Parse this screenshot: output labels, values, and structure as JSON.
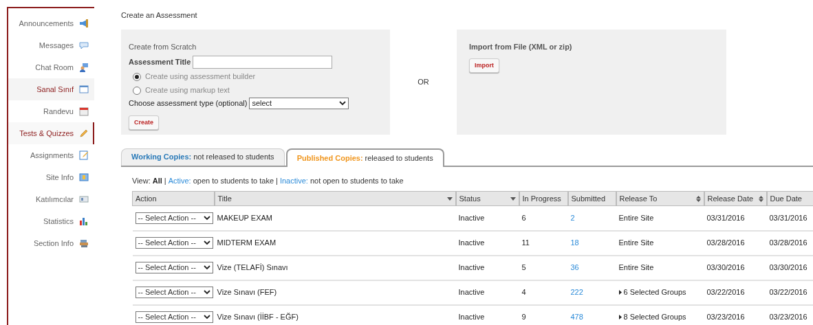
{
  "sidebar": {
    "items": [
      {
        "label": "Announcements",
        "selected": false,
        "hovered": false
      },
      {
        "label": "Messages",
        "selected": false,
        "hovered": false
      },
      {
        "label": "Chat Room",
        "selected": false,
        "hovered": false
      },
      {
        "label": "Sanal Sınıf",
        "selected": false,
        "hovered": true
      },
      {
        "label": "Randevu",
        "selected": false,
        "hovered": false
      },
      {
        "label": "Tests & Quizzes",
        "selected": true,
        "hovered": false
      },
      {
        "label": "Assignments",
        "selected": false,
        "hovered": false
      },
      {
        "label": "Site Info",
        "selected": false,
        "hovered": false
      },
      {
        "label": "Katılımcılar",
        "selected": false,
        "hovered": false
      },
      {
        "label": "Statistics",
        "selected": false,
        "hovered": false
      },
      {
        "label": "Section Info",
        "selected": false,
        "hovered": false
      }
    ]
  },
  "page_title": "Create an Assessment",
  "scratch": {
    "heading": "Create from Scratch",
    "title_label": "Assessment Title",
    "options": [
      {
        "label": "Create using assessment builder",
        "selected": true
      },
      {
        "label": "Create using markup text",
        "selected": false
      }
    ],
    "type_label": "Choose assessment type (optional)",
    "type_value": "select",
    "button": "Create"
  },
  "or_label": "OR",
  "import": {
    "heading": "Import from File (XML or zip)",
    "button": "Import"
  },
  "tabs": [
    {
      "name": "Working Copies:",
      "desc": "not released to students",
      "selected": false
    },
    {
      "name": "Published Copies:",
      "desc": "released to students",
      "selected": true
    }
  ],
  "view_filter": {
    "prefix": "View:",
    "separator": "|",
    "options": [
      {
        "label": "All",
        "selected": true
      },
      {
        "label": "Active:",
        "desc": "open to students to take",
        "selected": false
      },
      {
        "label": "Inactive:",
        "desc": "not open to students to take",
        "selected": false
      }
    ]
  },
  "table": {
    "columns": [
      {
        "label": "Action",
        "kind": "plain"
      },
      {
        "label": "Title",
        "kind": "dropdown"
      },
      {
        "label": "Status",
        "kind": "dropdown"
      },
      {
        "label": "In Progress",
        "kind": "plain"
      },
      {
        "label": "Submitted",
        "kind": "plain"
      },
      {
        "label": "Release To",
        "kind": "sortable"
      },
      {
        "label": "Release Date",
        "kind": "sortable"
      },
      {
        "label": "Due Date",
        "kind": "plain"
      }
    ],
    "rows": [
      {
        "action": "-- Select Action --",
        "title": "MAKEUP EXAM",
        "status": "Inactive",
        "in_progress": "6",
        "submitted": "2",
        "release_to": "Entire Site",
        "kind": "site",
        "release_date": "03/31/2016",
        "due_date": "03/31/2016"
      },
      {
        "action": "-- Select Action --",
        "title": "MIDTERM EXAM",
        "status": "Inactive",
        "in_progress": "11",
        "submitted": "18",
        "release_to": "Entire Site",
        "kind": "site",
        "release_date": "03/28/2016",
        "due_date": "03/28/2016"
      },
      {
        "action": "-- Select Action --",
        "title": "Vize (TELAFİ) Sınavı",
        "status": "Inactive",
        "in_progress": "5",
        "submitted": "36",
        "release_to": "Entire Site",
        "kind": "site",
        "release_date": "03/30/2016",
        "due_date": "03/30/2016"
      },
      {
        "action": "-- Select Action --",
        "title": "Vize Sınavı (FEF)",
        "status": "Inactive",
        "in_progress": "4",
        "submitted": "222",
        "release_to": "6 Selected Groups",
        "kind": "groups",
        "release_date": "03/22/2016",
        "due_date": "03/22/2016"
      },
      {
        "action": "-- Select Action --",
        "title": "Vize Sınavı (İİBF - EĞF)",
        "status": "Inactive",
        "in_progress": "9",
        "submitted": "478",
        "release_to": "8 Selected Groups",
        "kind": "groups",
        "release_date": "03/23/2016",
        "due_date": "03/23/2016"
      }
    ]
  }
}
